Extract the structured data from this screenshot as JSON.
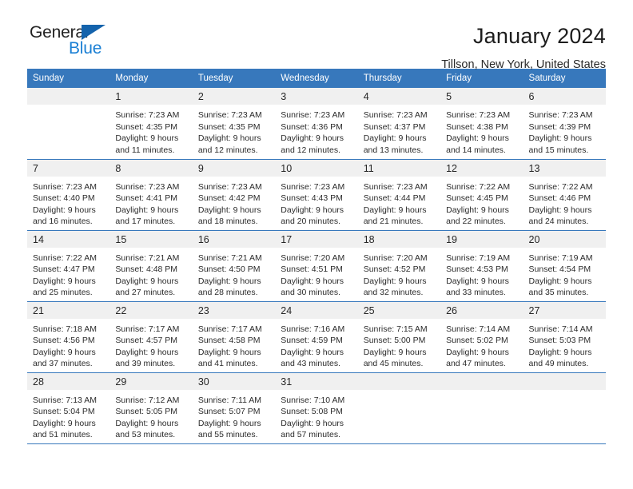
{
  "brand": {
    "name_part1": "General",
    "name_part2": "Blue",
    "color_dark": "#232323",
    "color_blue": "#1a7fd4",
    "triangle_color": "#1463ac"
  },
  "header": {
    "title": "January 2024",
    "location": "Tillson, New York, United States",
    "accent_color": "#3778bc"
  },
  "weekdays": [
    "Sunday",
    "Monday",
    "Tuesday",
    "Wednesday",
    "Thursday",
    "Friday",
    "Saturday"
  ],
  "weeks": [
    [
      {
        "day": "",
        "details": ""
      },
      {
        "day": "1",
        "details": "Sunrise: 7:23 AM\nSunset: 4:35 PM\nDaylight: 9 hours\nand 11 minutes."
      },
      {
        "day": "2",
        "details": "Sunrise: 7:23 AM\nSunset: 4:35 PM\nDaylight: 9 hours\nand 12 minutes."
      },
      {
        "day": "3",
        "details": "Sunrise: 7:23 AM\nSunset: 4:36 PM\nDaylight: 9 hours\nand 12 minutes."
      },
      {
        "day": "4",
        "details": "Sunrise: 7:23 AM\nSunset: 4:37 PM\nDaylight: 9 hours\nand 13 minutes."
      },
      {
        "day": "5",
        "details": "Sunrise: 7:23 AM\nSunset: 4:38 PM\nDaylight: 9 hours\nand 14 minutes."
      },
      {
        "day": "6",
        "details": "Sunrise: 7:23 AM\nSunset: 4:39 PM\nDaylight: 9 hours\nand 15 minutes."
      }
    ],
    [
      {
        "day": "7",
        "details": "Sunrise: 7:23 AM\nSunset: 4:40 PM\nDaylight: 9 hours\nand 16 minutes."
      },
      {
        "day": "8",
        "details": "Sunrise: 7:23 AM\nSunset: 4:41 PM\nDaylight: 9 hours\nand 17 minutes."
      },
      {
        "day": "9",
        "details": "Sunrise: 7:23 AM\nSunset: 4:42 PM\nDaylight: 9 hours\nand 18 minutes."
      },
      {
        "day": "10",
        "details": "Sunrise: 7:23 AM\nSunset: 4:43 PM\nDaylight: 9 hours\nand 20 minutes."
      },
      {
        "day": "11",
        "details": "Sunrise: 7:23 AM\nSunset: 4:44 PM\nDaylight: 9 hours\nand 21 minutes."
      },
      {
        "day": "12",
        "details": "Sunrise: 7:22 AM\nSunset: 4:45 PM\nDaylight: 9 hours\nand 22 minutes."
      },
      {
        "day": "13",
        "details": "Sunrise: 7:22 AM\nSunset: 4:46 PM\nDaylight: 9 hours\nand 24 minutes."
      }
    ],
    [
      {
        "day": "14",
        "details": "Sunrise: 7:22 AM\nSunset: 4:47 PM\nDaylight: 9 hours\nand 25 minutes."
      },
      {
        "day": "15",
        "details": "Sunrise: 7:21 AM\nSunset: 4:48 PM\nDaylight: 9 hours\nand 27 minutes."
      },
      {
        "day": "16",
        "details": "Sunrise: 7:21 AM\nSunset: 4:50 PM\nDaylight: 9 hours\nand 28 minutes."
      },
      {
        "day": "17",
        "details": "Sunrise: 7:20 AM\nSunset: 4:51 PM\nDaylight: 9 hours\nand 30 minutes."
      },
      {
        "day": "18",
        "details": "Sunrise: 7:20 AM\nSunset: 4:52 PM\nDaylight: 9 hours\nand 32 minutes."
      },
      {
        "day": "19",
        "details": "Sunrise: 7:19 AM\nSunset: 4:53 PM\nDaylight: 9 hours\nand 33 minutes."
      },
      {
        "day": "20",
        "details": "Sunrise: 7:19 AM\nSunset: 4:54 PM\nDaylight: 9 hours\nand 35 minutes."
      }
    ],
    [
      {
        "day": "21",
        "details": "Sunrise: 7:18 AM\nSunset: 4:56 PM\nDaylight: 9 hours\nand 37 minutes."
      },
      {
        "day": "22",
        "details": "Sunrise: 7:17 AM\nSunset: 4:57 PM\nDaylight: 9 hours\nand 39 minutes."
      },
      {
        "day": "23",
        "details": "Sunrise: 7:17 AM\nSunset: 4:58 PM\nDaylight: 9 hours\nand 41 minutes."
      },
      {
        "day": "24",
        "details": "Sunrise: 7:16 AM\nSunset: 4:59 PM\nDaylight: 9 hours\nand 43 minutes."
      },
      {
        "day": "25",
        "details": "Sunrise: 7:15 AM\nSunset: 5:00 PM\nDaylight: 9 hours\nand 45 minutes."
      },
      {
        "day": "26",
        "details": "Sunrise: 7:14 AM\nSunset: 5:02 PM\nDaylight: 9 hours\nand 47 minutes."
      },
      {
        "day": "27",
        "details": "Sunrise: 7:14 AM\nSunset: 5:03 PM\nDaylight: 9 hours\nand 49 minutes."
      }
    ],
    [
      {
        "day": "28",
        "details": "Sunrise: 7:13 AM\nSunset: 5:04 PM\nDaylight: 9 hours\nand 51 minutes."
      },
      {
        "day": "29",
        "details": "Sunrise: 7:12 AM\nSunset: 5:05 PM\nDaylight: 9 hours\nand 53 minutes."
      },
      {
        "day": "30",
        "details": "Sunrise: 7:11 AM\nSunset: 5:07 PM\nDaylight: 9 hours\nand 55 minutes."
      },
      {
        "day": "31",
        "details": "Sunrise: 7:10 AM\nSunset: 5:08 PM\nDaylight: 9 hours\nand 57 minutes."
      },
      {
        "day": "",
        "details": ""
      },
      {
        "day": "",
        "details": ""
      },
      {
        "day": "",
        "details": ""
      }
    ]
  ]
}
